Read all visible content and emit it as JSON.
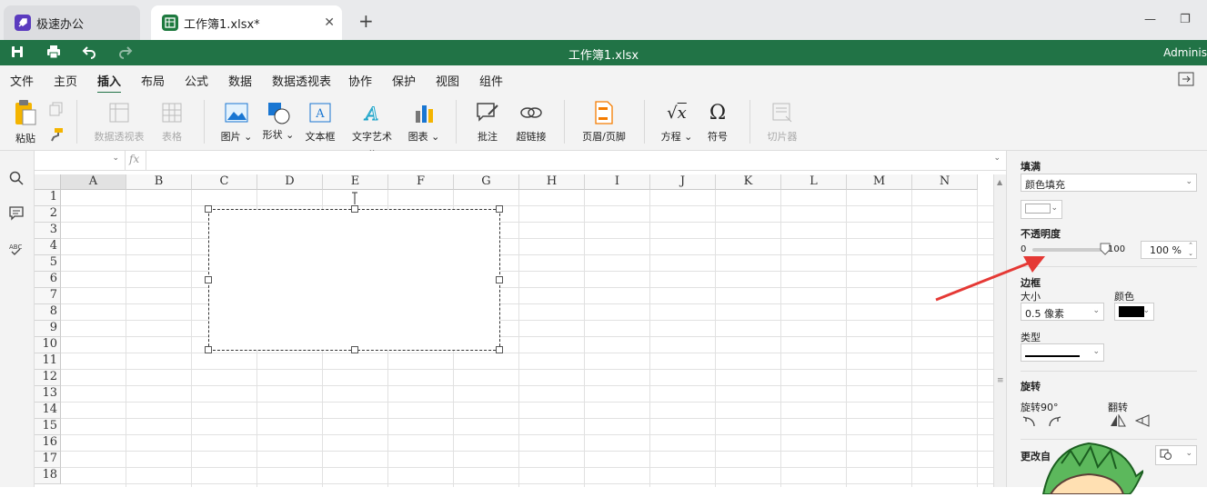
{
  "tabs": [
    {
      "label": "极速办公"
    },
    {
      "label": "工作簿1.xlsx*"
    }
  ],
  "title": "工作簿1.xlsx",
  "user": "Adminis",
  "menu": [
    "文件",
    "主页",
    "插入",
    "布局",
    "公式",
    "数据",
    "数据透视表",
    "协作",
    "保护",
    "视图",
    "组件"
  ],
  "active_menu": "插入",
  "toolbar": {
    "paste": "粘贴",
    "pivot": "数据透视表",
    "table": "表格",
    "picture": "图片",
    "shape": "形状",
    "textbox": "文本框",
    "wordart": "文字艺术",
    "chart": "图表",
    "comment": "批注",
    "hyperlink": "超链接",
    "header_footer": "页眉/页脚",
    "equation": "方程",
    "symbol": "符号",
    "slicer": "切片器"
  },
  "formula": {
    "fx": "fx"
  },
  "columns": [
    "A",
    "B",
    "C",
    "D",
    "E",
    "F",
    "G",
    "H",
    "I",
    "J",
    "K",
    "L",
    "M",
    "N"
  ],
  "rows": [
    "1",
    "2",
    "3",
    "4",
    "5",
    "6",
    "7",
    "8",
    "9",
    "10",
    "11",
    "12",
    "13",
    "14",
    "15",
    "16",
    "17",
    "18"
  ],
  "panel": {
    "fill_title": "填满",
    "fill_type": "颜色填充",
    "opacity_title": "不透明度",
    "opacity_min": "0",
    "opacity_max": "100",
    "opacity_value": "100 %",
    "opacity_level": 100,
    "border_title": "边框",
    "size_label": "大小",
    "color_label": "颜色",
    "size_value": "0.5 像素",
    "type_label": "类型",
    "rotation_title": "旋转",
    "rotate90_label": "旋转90°",
    "flip_label": "翻转",
    "change_label": "更改自"
  },
  "colors": {
    "green": "#217346",
    "arrow": "#e53935"
  }
}
